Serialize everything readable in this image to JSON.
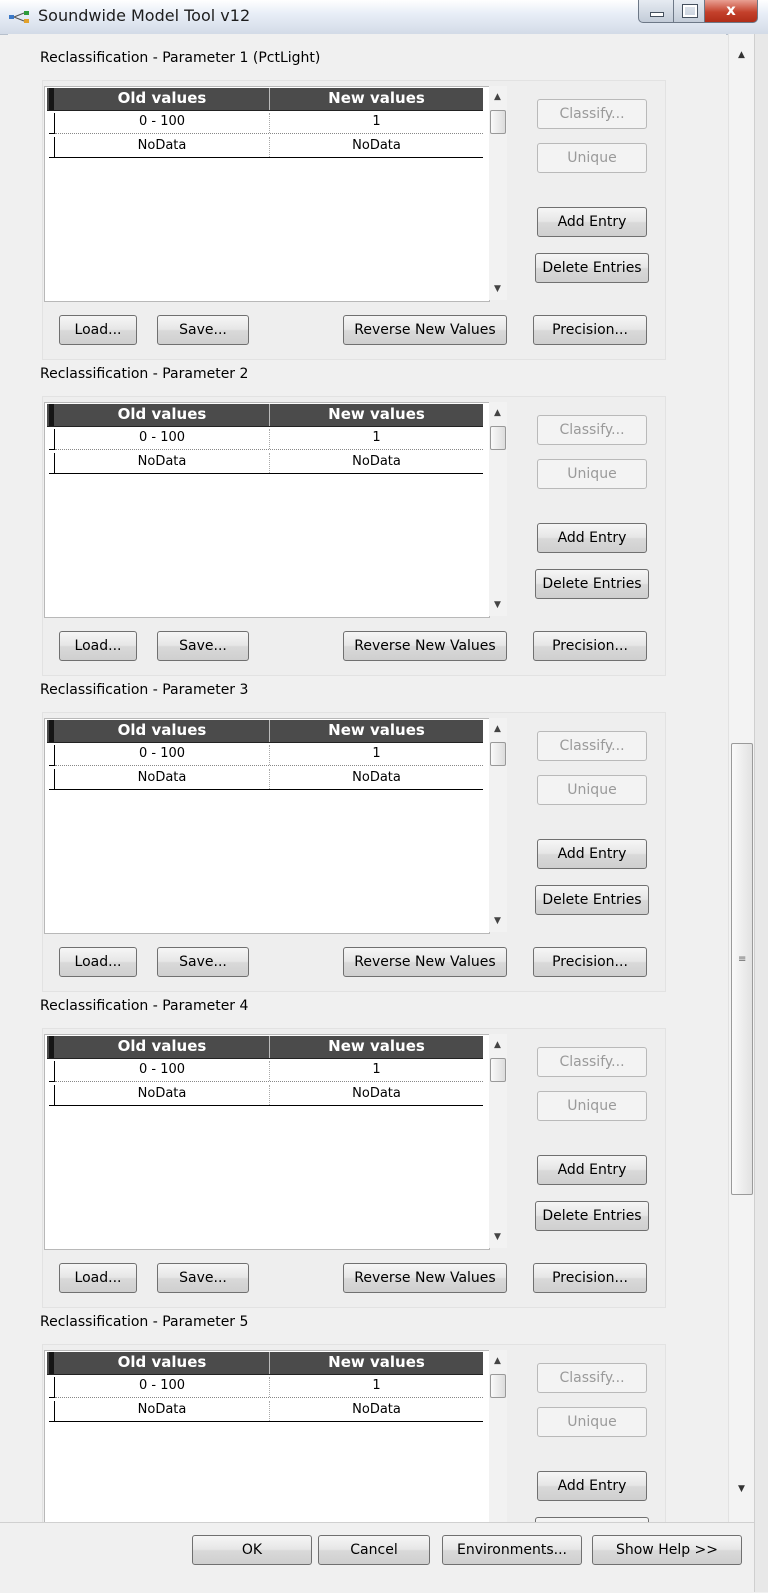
{
  "window": {
    "title": "Soundwide Model Tool v12",
    "close_glyph": "x"
  },
  "table_headers": {
    "old": "Old values",
    "new": "New values"
  },
  "sections": [
    {
      "label": "Reclassification - Parameter 1 (PctLight)",
      "rows": [
        {
          "old": "0 - 100",
          "new": "1"
        },
        {
          "old": "NoData",
          "new": "NoData"
        }
      ]
    },
    {
      "label": "Reclassification - Parameter 2",
      "rows": [
        {
          "old": "0 - 100",
          "new": "1"
        },
        {
          "old": "NoData",
          "new": "NoData"
        }
      ]
    },
    {
      "label": "Reclassification - Parameter 3",
      "rows": [
        {
          "old": "0 - 100",
          "new": "1"
        },
        {
          "old": "NoData",
          "new": "NoData"
        }
      ]
    },
    {
      "label": "Reclassification - Parameter 4",
      "rows": [
        {
          "old": "0 - 100",
          "new": "1"
        },
        {
          "old": "NoData",
          "new": "NoData"
        }
      ]
    },
    {
      "label": "Reclassification - Parameter 5",
      "rows": [
        {
          "old": "0 - 100",
          "new": "1"
        },
        {
          "old": "NoData",
          "new": "NoData"
        }
      ]
    }
  ],
  "buttons": {
    "classify": "Classify...",
    "unique": "Unique",
    "add_entry": "Add Entry",
    "delete_entries": "Delete Entries",
    "load": "Load...",
    "save": "Save...",
    "reverse": "Reverse New Values",
    "precision": "Precision..."
  },
  "footer": {
    "ok": "OK",
    "cancel": "Cancel",
    "environments": "Environments...",
    "show_help": "Show Help >>"
  },
  "icons": {
    "app": "model-tool-icon",
    "scroll_up": "scroll-up-arrow-icon",
    "scroll_down": "scroll-down-arrow-icon"
  }
}
